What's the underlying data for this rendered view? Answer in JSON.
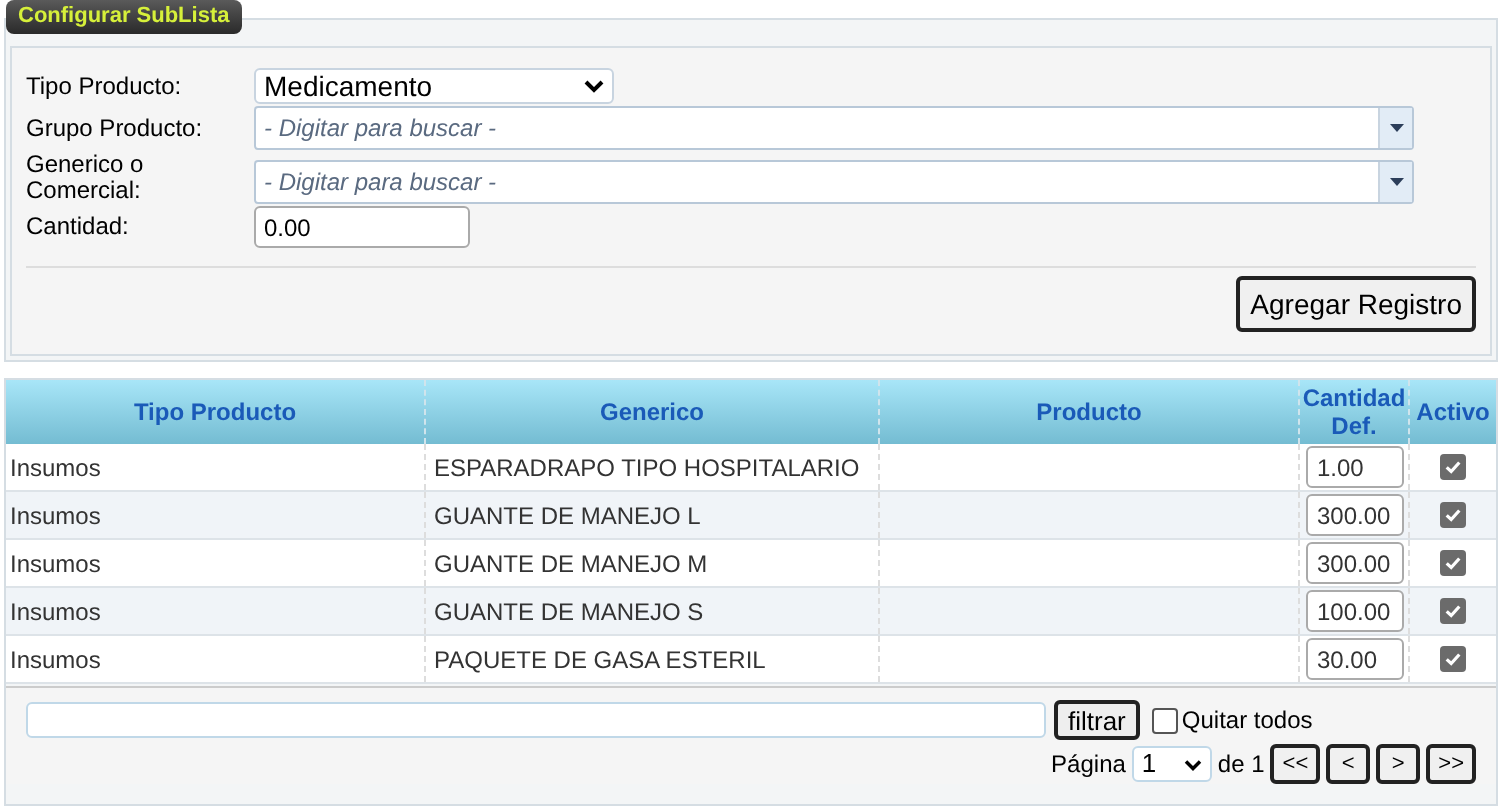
{
  "legend": "Configurar SubLista",
  "form": {
    "fields": [
      {
        "kind": "select",
        "label": "Tipo Producto:",
        "value": "Medicamento"
      },
      {
        "kind": "combo",
        "label": "Grupo Producto:",
        "placeholder": "- Digitar para buscar -"
      },
      {
        "kind": "combo",
        "label": "Generico o Comercial:",
        "placeholder": "- Digitar para buscar -"
      },
      {
        "kind": "text",
        "label": "Cantidad:",
        "value": "0.00"
      }
    ],
    "button": "Agregar Registro"
  },
  "table": {
    "columns": [
      "Tipo Producto",
      "Generico",
      "Producto",
      "Cantidad Def.",
      "Activo"
    ],
    "rows": [
      {
        "tipo": "Insumos",
        "generico": "ESPARADRAPO TIPO HOSPITALARIO",
        "cantidad": "1.00",
        "activo": true
      },
      {
        "tipo": "Insumos",
        "generico": "GUANTE DE MANEJO L",
        "cantidad": "300.00",
        "activo": true
      },
      {
        "tipo": "Insumos",
        "generico": "GUANTE DE MANEJO M",
        "cantidad": "300.00",
        "activo": true
      },
      {
        "tipo": "Insumos",
        "generico": "GUANTE DE MANEJO S",
        "cantidad": "100.00",
        "activo": true
      },
      {
        "tipo": "Insumos",
        "generico": "PAQUETE DE GASA ESTERIL",
        "cantidad": "30.00",
        "activo": true
      }
    ]
  },
  "footer": {
    "filter_button": "filtrar",
    "clear_all": {
      "label": "Quitar todos",
      "checked": false
    },
    "pager": {
      "label": "Página",
      "page": "1",
      "of": "de 1",
      "buttons": [
        "<<",
        "<",
        ">",
        ">>"
      ]
    }
  }
}
